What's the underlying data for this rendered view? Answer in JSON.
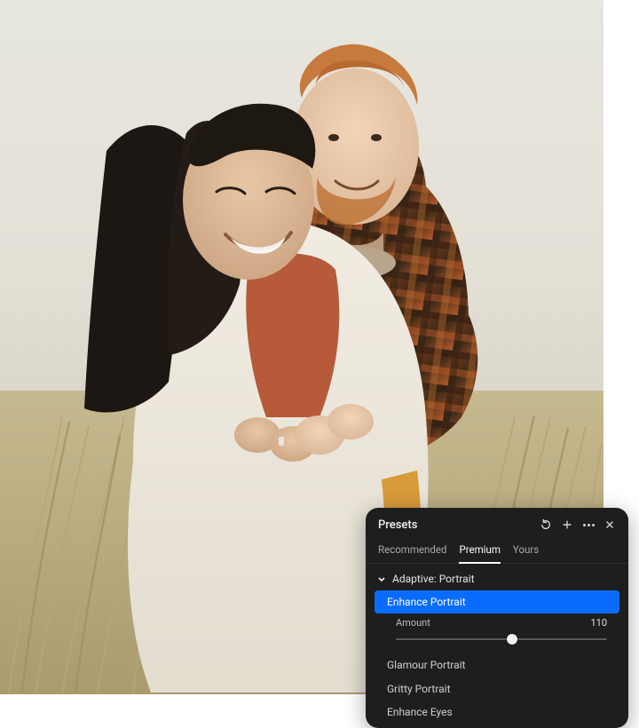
{
  "panel": {
    "title": "Presets",
    "header_icons": [
      "reset-icon",
      "add-icon",
      "more-icon",
      "close-icon"
    ],
    "tabs": [
      {
        "label": "Recommended",
        "active": false
      },
      {
        "label": "Premium",
        "active": true
      },
      {
        "label": "Yours",
        "active": false
      }
    ],
    "group": {
      "label": "Adaptive: Portrait",
      "expanded": true
    },
    "presets": [
      {
        "label": "Enhance Portrait",
        "selected": true
      },
      {
        "label": "Glamour Portrait",
        "selected": false
      },
      {
        "label": "Gritty Portrait",
        "selected": false
      },
      {
        "label": "Enhance Eyes",
        "selected": false
      }
    ],
    "amount": {
      "label": "Amount",
      "value": 110,
      "min": 0,
      "max": 200
    }
  },
  "colors": {
    "panel_bg": "#1e1e1e",
    "accent": "#0a6cff",
    "text": "#e8e8e8",
    "muted": "#a9a9a9"
  }
}
